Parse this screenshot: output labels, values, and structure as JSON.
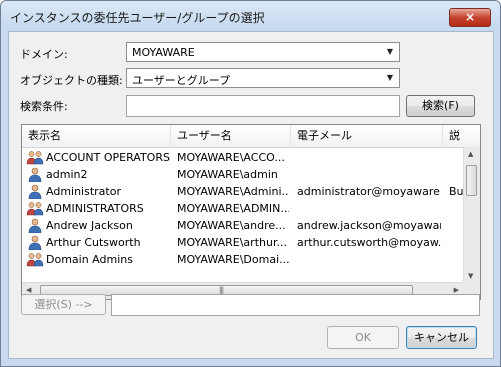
{
  "window": {
    "title": "インスタンスの委任先ユーザー/グループの選択",
    "close_glyph": "×"
  },
  "domain": {
    "label": "ドメイン:",
    "value": "MOYAWARE"
  },
  "object_type": {
    "label": "オブジェクトの種類:",
    "value": "ユーザーとグループ"
  },
  "search": {
    "label": "検索条件:",
    "value": "",
    "button": "検索(F)"
  },
  "columns": [
    "表示名",
    "ユーザー名",
    "電子メール",
    "説"
  ],
  "rows": [
    {
      "name": "ACCOUNT OPERATORS",
      "user": "MOYAWARE\\ACCO...",
      "email": "",
      "extra": "",
      "icon": "group-icon"
    },
    {
      "name": "admin2",
      "user": "MOYAWARE\\admin",
      "email": "",
      "extra": "",
      "icon": "user-icon"
    },
    {
      "name": "Administrator",
      "user": "MOYAWARE\\Admini...",
      "email": "administrator@moyaware...",
      "extra": "Bui",
      "icon": "user-icon"
    },
    {
      "name": "ADMINISTRATORS",
      "user": "MOYAWARE\\ADMIN...",
      "email": "",
      "extra": "",
      "icon": "group-icon"
    },
    {
      "name": "Andrew Jackson",
      "user": "MOYAWARE\\andre...",
      "email": "andrew.jackson@moyawar...",
      "extra": "",
      "icon": "user-icon"
    },
    {
      "name": "Arthur Cutsworth",
      "user": "MOYAWARE\\arthur...",
      "email": "arthur.cutsworth@moyaw...",
      "extra": "",
      "icon": "user-icon"
    },
    {
      "name": "Domain Admins",
      "user": "MOYAWARE\\Domai...",
      "email": "",
      "extra": "",
      "icon": "group-icon"
    }
  ],
  "select": {
    "button": "選択(S) -->",
    "value": ""
  },
  "ok_button": "OK",
  "cancel_button": "キャンセル"
}
